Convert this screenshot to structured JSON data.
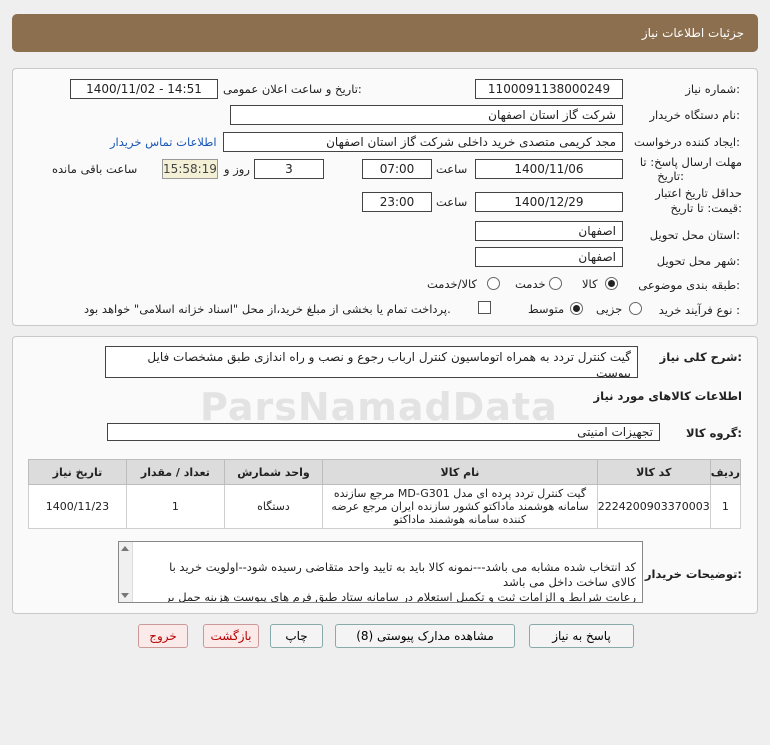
{
  "header": {
    "title": "جزئیات اطلاعات نیاز"
  },
  "form": {
    "need_number_label": "شماره نیاز:",
    "need_number": "1100091138000249",
    "announce_label": "تاریخ و ساعت اعلان عمومی:",
    "announce_value": "1400/11/02 - 14:51",
    "buyer_org_label": "نام دستگاه خریدار:",
    "buyer_org": "شرکت گاز استان اصفهان",
    "creator_label": "ایجاد کننده درخواست:",
    "creator": "مجد کریمی متصدی خرید داخلی شرکت گاز استان اصفهان",
    "contact_link": "اطلاعات تماس خریدار",
    "reply_deadline_label": "مهلت ارسال پاسخ: تا",
    "reply_deadline_label2": "تاریخ:",
    "reply_date": "1400/11/06",
    "time_label": "ساعت",
    "reply_time": "07:00",
    "days_value": "3",
    "days_label": "روز و",
    "remaining_time": "15:58:19",
    "remaining_label": "ساعت باقی مانده",
    "validity_label": "حداقل تاریخ اعتبار",
    "validity_label2": "قیمت: تا تاریخ:",
    "validity_date": "1400/12/29",
    "validity_time": "23:00",
    "province_label": "استان محل تحویل:",
    "province": "اصفهان",
    "city_label": "شهر محل تحویل:",
    "city": "اصفهان",
    "category_label": "طبقه بندی موضوعی:",
    "category_options": [
      "کالا",
      "خدمت",
      "کالا/خدمت"
    ],
    "category_selected": "کالا",
    "process_label": "نوع فرآیند خرید :",
    "process_options": [
      "جزیی",
      "متوسط"
    ],
    "process_selected": "متوسط",
    "payment_note": "پرداخت تمام یا بخشی از مبلغ خرید،از محل \"اسناد خزانه اسلامی\" خواهد بود."
  },
  "description": {
    "label": "شرح کلی نیاز:",
    "text": "گیت کنترل تردد به همراه اتوماسیون کنترل ارباب رجوع و نصب و راه اندازی طبق مشخصات فایل پیوست"
  },
  "goods": {
    "section_title": "اطلاعات کالاهای مورد نیاز",
    "group_label": "گروه کالا:",
    "group_value": "تجهیزات امنیتی",
    "columns": [
      "ردیف",
      "کد کالا",
      "نام کالا",
      "واحد شمارش",
      "تعداد / مقدار",
      "تاریخ نیاز"
    ],
    "rows": [
      {
        "row": "1",
        "code": "2224200903370003",
        "name": "گیت کنترل تردد پرده ای مدل MD-G301 مرجع سازنده سامانه هوشمند ماداکتو کشور سازنده ایران مرجع عرضه کننده سامانه هوشمند ماداکتو",
        "unit": "دستگاه",
        "qty": "1",
        "date": "1400/11/23"
      }
    ]
  },
  "buyer_notes": {
    "label": "توضیحات خریدار:",
    "text": "کد انتخاب شده مشابه می باشد---نمونه کالا باید به تایید واحد متقاضی رسیده شود--اولویت خرید با کالای ساخت داخل می باشد\nرعایت شرایط و الزامات ثبت و تکمیل استعلام در سامانه ستاد  طبق فرم های پیوست هزینه حمل بر عهده فروشنده می باشد."
  },
  "buttons": {
    "reply": "پاسخ به نیاز",
    "attachments": "مشاهده مدارک پیوستی (8)",
    "print": "چاپ",
    "back": "بازگشت",
    "exit": "خروج"
  },
  "watermark": "ParsNamadData"
}
